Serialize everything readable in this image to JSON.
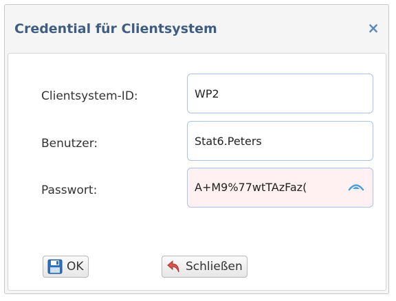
{
  "dialog": {
    "title": "Credential für Clientsystem",
    "close_glyph": "×"
  },
  "form": {
    "clientsystem_label": "Clientsystem-ID:",
    "clientsystem_value": "WP2",
    "benutzer_label": "Benutzer:",
    "benutzer_value": "Stat6.Peters",
    "passwort_label": "Passwort:",
    "passwort_value": "A+M9%77wtTAzFaz("
  },
  "buttons": {
    "ok_label": "OK",
    "close_label": "Schließen"
  },
  "icons": {
    "close": "close-icon",
    "reveal": "eye-reveal-icon",
    "save": "floppy-disk-icon",
    "undo": "undo-arrow-icon"
  },
  "colors": {
    "title": "#3f5d80",
    "accent": "#5b86c0",
    "field_border": "#a9c4e8",
    "password_bg": "#fff1f1",
    "undo_red": "#d9534f"
  }
}
